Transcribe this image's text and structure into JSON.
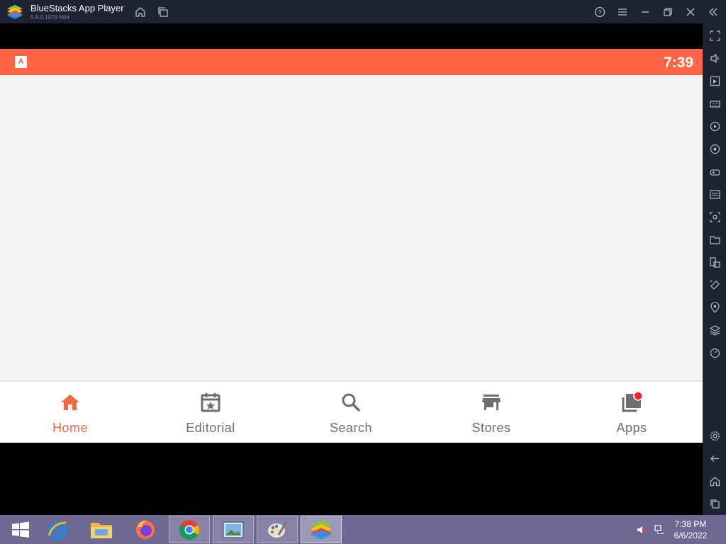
{
  "window": {
    "title": "BlueStacks App Player",
    "version": "5.8.0.1079  N64"
  },
  "status_bar": {
    "time": "7:39",
    "app_icon_letter": "A",
    "color": "#ff6445"
  },
  "bottom_nav": {
    "items": [
      {
        "label": "Home",
        "icon": "home-icon",
        "active": true
      },
      {
        "label": "Editorial",
        "icon": "calendar-star-icon",
        "active": false
      },
      {
        "label": "Search",
        "icon": "search-icon",
        "active": false
      },
      {
        "label": "Stores",
        "icon": "store-icon",
        "active": false
      },
      {
        "label": "Apps",
        "icon": "apps-library-icon",
        "active": false,
        "badge": true
      }
    ],
    "active_color": "#ff6445",
    "inactive_color": "#6e6e6e"
  },
  "sidebar": {
    "icons": [
      "fullscreen-icon",
      "volume-icon",
      "media-icon",
      "keyboard-icon",
      "macro-icon",
      "sync-icon",
      "gamepad-icon",
      "apk-icon",
      "screenshot-icon",
      "folder-icon",
      "multi-instance-icon",
      "rotate-icon",
      "location-icon",
      "layers-icon",
      "eco-mode-icon",
      "settings-icon",
      "back-icon",
      "home-icon",
      "recents-icon"
    ]
  },
  "taskbar": {
    "clock_time": "7:38 PM",
    "clock_date": "6/6/2022",
    "apps": [
      "start-icon",
      "internet-explorer-icon",
      "file-explorer-icon",
      "firefox-icon",
      "chrome-icon",
      "photos-icon",
      "paint-icon",
      "bluestacks-icon"
    ]
  }
}
